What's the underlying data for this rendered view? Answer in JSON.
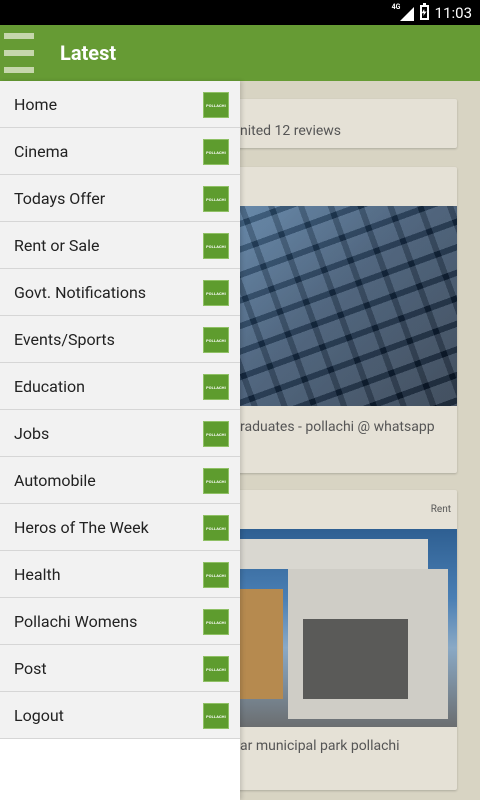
{
  "status_bar": {
    "time": "11:03",
    "network": "4G"
  },
  "app_bar": {
    "title": "Latest"
  },
  "cards": [
    {
      "text": "nited 12 reviews"
    },
    {
      "text": "raduates - pollachi @ whatsapp"
    },
    {
      "tag": "Rent",
      "text": "ar municipal park pollachi"
    }
  ],
  "drawer": {
    "logo_text": "POLLACHI",
    "items": [
      {
        "label": "Home"
      },
      {
        "label": "Cinema"
      },
      {
        "label": "Todays Offer"
      },
      {
        "label": "Rent or Sale"
      },
      {
        "label": "Govt. Notifications"
      },
      {
        "label": "Events/Sports"
      },
      {
        "label": "Education"
      },
      {
        "label": "Jobs"
      },
      {
        "label": "Automobile"
      },
      {
        "label": "Heros of The Week"
      },
      {
        "label": "Health"
      },
      {
        "label": "Pollachi Womens"
      },
      {
        "label": "Post"
      },
      {
        "label": "Logout"
      }
    ]
  },
  "colors": {
    "app_bar": "#669b34",
    "status_bar": "#000000",
    "drawer_item": "#f2f2f2",
    "background": "#d8d4c3"
  }
}
